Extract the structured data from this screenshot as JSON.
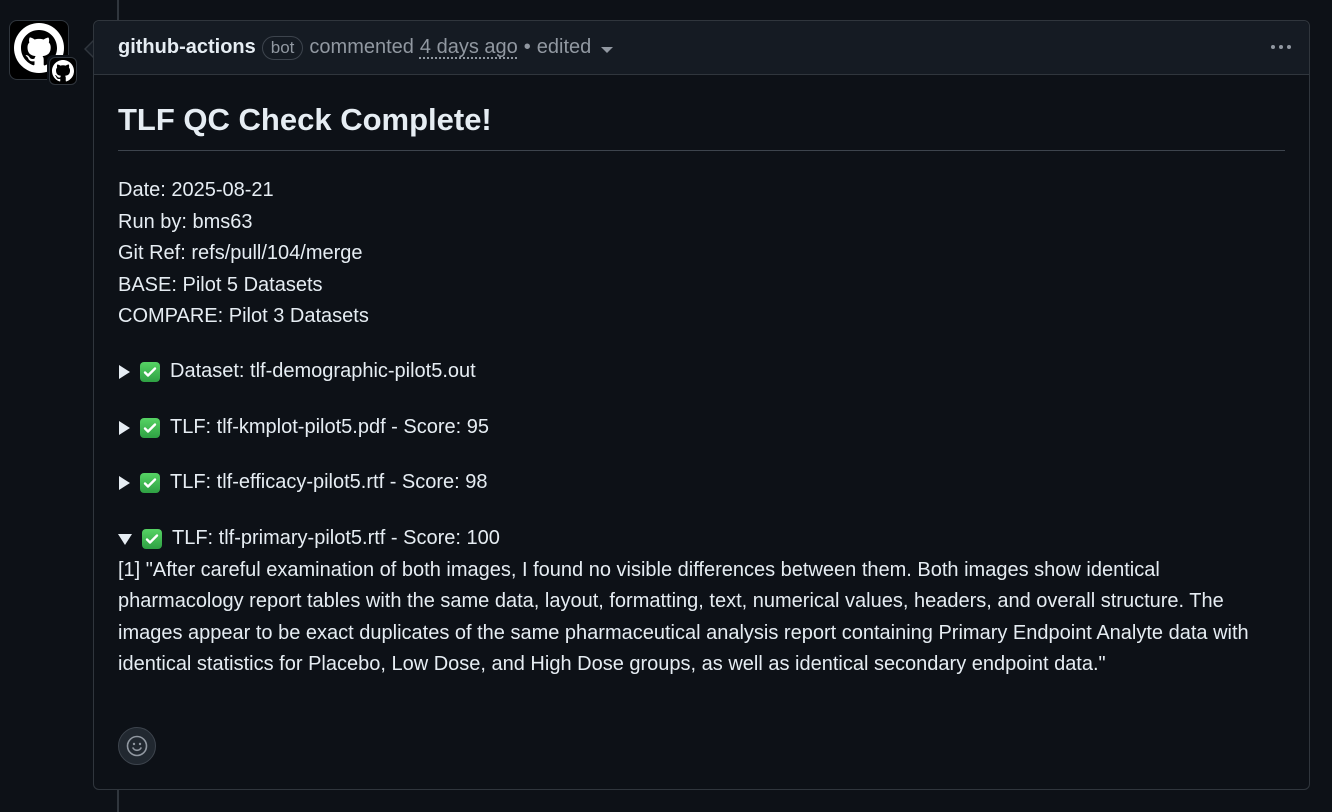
{
  "comment": {
    "author": "github-actions",
    "bot_label": "bot",
    "action": "commented",
    "time": "4 days ago",
    "separator": "•",
    "edited": "edited"
  },
  "body": {
    "title": "TLF QC Check Complete!",
    "meta": [
      "Date: 2025-08-21",
      "Run by: bms63",
      "Git Ref: refs/pull/104/merge",
      "BASE: Pilot 5 Datasets",
      "COMPARE: Pilot 3 Datasets"
    ],
    "items": [
      {
        "label": "Dataset: tlf-demographic-pilot5.out",
        "expanded": false
      },
      {
        "label": "TLF: tlf-kmplot-pilot5.pdf - Score: 95",
        "expanded": false
      },
      {
        "label": "TLF: tlf-efficacy-pilot5.rtf - Score: 98",
        "expanded": false
      },
      {
        "label": "TLF: tlf-primary-pilot5.rtf - Score: 100",
        "expanded": true
      }
    ],
    "expanded_text": "[1] \"After careful examination of both images, I found no visible differences between them. Both images show identical pharmacology report tables with the same data, layout, formatting, text, numerical values, headers, and overall structure. The images appear to be exact duplicates of the same pharmaceutical analysis report containing Primary Endpoint Analyte data with identical statistics for Placebo, Low Dose, and High Dose groups, as well as identical secondary endpoint data.\""
  },
  "icons": {
    "avatar": "github-octocat-icon",
    "badge": "github-app-icon",
    "check": "white-check-mark-icon",
    "more": "kebab-horizontal-icon",
    "reaction": "smiley-icon"
  },
  "colors": {
    "background": "#0d1117",
    "header_bg": "#151b23",
    "border": "#30363d",
    "muted": "#9198a1",
    "check_green": "#3fb950"
  }
}
